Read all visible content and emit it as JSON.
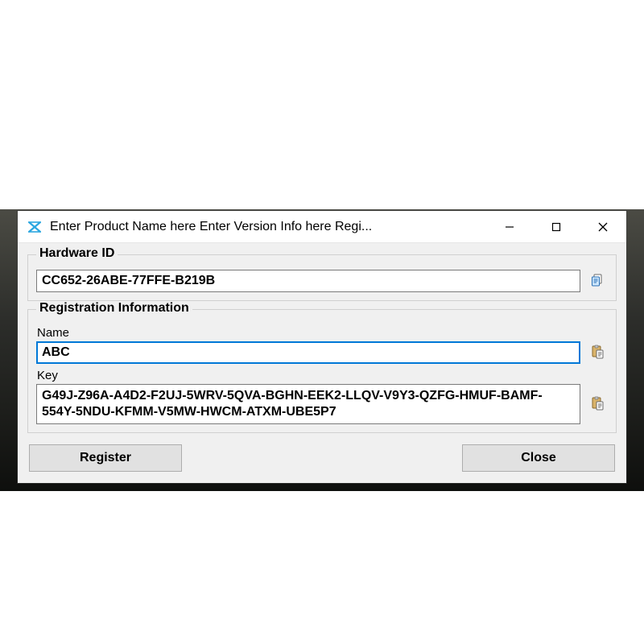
{
  "window": {
    "title": "Enter Product Name here Enter Version Info here Regi..."
  },
  "hardware": {
    "legend": "Hardware ID",
    "value": "CC652-26ABE-77FFE-B219B"
  },
  "registration": {
    "legend": "Registration Information",
    "name_label": "Name",
    "name_value": "ABC",
    "key_label": "Key",
    "key_value": "G49J-Z96A-A4D2-F2UJ-5WRV-5QVA-BGHN-EEK2-LLQV-V9Y3-QZFG-HMUF-BAMF-554Y-5NDU-KFMM-V5MW-HWCM-ATXM-UBE5P7"
  },
  "buttons": {
    "register": "Register",
    "close": "Close"
  }
}
